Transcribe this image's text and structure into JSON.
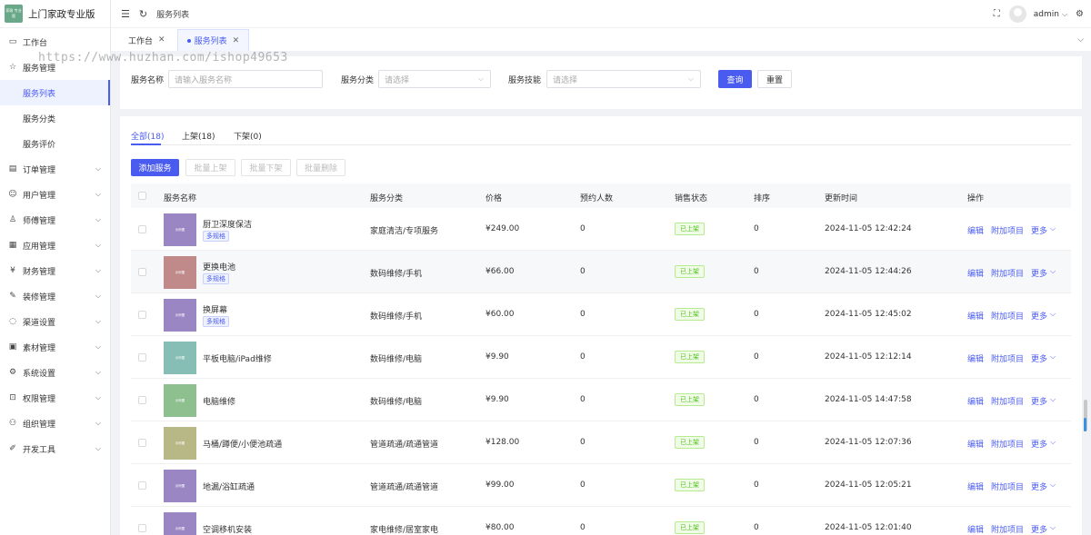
{
  "app": {
    "logo_text": "家政 专业版",
    "title": "上门家政专业版"
  },
  "sidebar": {
    "items": [
      {
        "label": "工作台",
        "icon": "monitor-icon"
      },
      {
        "label": "服务管理",
        "icon": "star-icon"
      },
      {
        "label": "服务列表",
        "sub": true,
        "active": true
      },
      {
        "label": "服务分类",
        "sub": true
      },
      {
        "label": "服务评价",
        "sub": true
      },
      {
        "label": "订单管理",
        "icon": "file-icon"
      },
      {
        "label": "用户管理",
        "icon": "user-icon"
      },
      {
        "label": "师傅管理",
        "icon": "worker-icon"
      },
      {
        "label": "应用管理",
        "icon": "grid-icon"
      },
      {
        "label": "财务管理",
        "icon": "money-icon"
      },
      {
        "label": "装修管理",
        "icon": "brush-icon"
      },
      {
        "label": "渠道设置",
        "icon": "chat-icon"
      },
      {
        "label": "素材管理",
        "icon": "image-icon"
      },
      {
        "label": "系统设置",
        "icon": "gear-icon"
      },
      {
        "label": "权限管理",
        "icon": "lock-icon"
      },
      {
        "label": "组织管理",
        "icon": "org-icon"
      },
      {
        "label": "开发工具",
        "icon": "tool-icon"
      }
    ]
  },
  "header": {
    "breadcrumb": "服务列表",
    "username": "admin"
  },
  "tabs": [
    {
      "label": "工作台"
    },
    {
      "label": "服务列表",
      "active": true
    }
  ],
  "watermark": "https://www.huzhan.com/ishop49653",
  "filter": {
    "name_label": "服务名称",
    "name_placeholder": "请输入服务名称",
    "category_label": "服务分类",
    "category_placeholder": "请选择",
    "skill_label": "服务技能",
    "skill_placeholder": "请选择",
    "search_label": "查询",
    "reset_label": "重置"
  },
  "status_tabs": [
    "全部(18)",
    "上架(18)",
    "下架(0)"
  ],
  "actions": {
    "add": "添加服务",
    "batch_on": "批量上架",
    "batch_off": "批量下架",
    "batch_delete": "批量删除"
  },
  "table": {
    "columns": [
      "服务名称",
      "服务分类",
      "价格",
      "预约人数",
      "销售状态",
      "排序",
      "更新时间",
      "操作"
    ],
    "thumb_label": "示例图",
    "op_edit": "编辑",
    "op_extra": "附加项目",
    "op_more": "更多",
    "rows": [
      {
        "name": "厨卫深度保洁",
        "tag": "多规格",
        "category": "家庭清洁/专项服务",
        "price": "¥249.00",
        "bookings": "0",
        "status": "已上架",
        "sort": "0",
        "updated": "2024-11-05 12:42:24",
        "thumb_color": "#9b86c4"
      },
      {
        "name": "更换电池",
        "tag": "多规格",
        "category": "数码维修/手机",
        "price": "¥66.00",
        "bookings": "0",
        "status": "已上架",
        "sort": "0",
        "updated": "2024-11-05 12:44:26",
        "thumb_color": "#c08a8a"
      },
      {
        "name": "换屏幕",
        "tag": "多规格",
        "category": "数码维修/手机",
        "price": "¥60.00",
        "bookings": "0",
        "status": "已上架",
        "sort": "0",
        "updated": "2024-11-05 12:45:02",
        "thumb_color": "#9b86c4"
      },
      {
        "name": "平板电脑/iPad维修",
        "tag": "",
        "category": "数码维修/电脑",
        "price": "¥9.90",
        "bookings": "0",
        "status": "已上架",
        "sort": "0",
        "updated": "2024-11-05 12:12:14",
        "thumb_color": "#86bdb5"
      },
      {
        "name": "电脑维修",
        "tag": "",
        "category": "数码维修/电脑",
        "price": "¥9.90",
        "bookings": "0",
        "status": "已上架",
        "sort": "0",
        "updated": "2024-11-05 14:47:58",
        "thumb_color": "#8dbf8f"
      },
      {
        "name": "马桶/蹲便/小便池疏通",
        "tag": "",
        "category": "管道疏通/疏通管道",
        "price": "¥128.00",
        "bookings": "0",
        "status": "已上架",
        "sort": "0",
        "updated": "2024-11-05 12:07:36",
        "thumb_color": "#b8b886"
      },
      {
        "name": "地漏/浴缸疏通",
        "tag": "",
        "category": "管道疏通/疏通管道",
        "price": "¥99.00",
        "bookings": "0",
        "status": "已上架",
        "sort": "0",
        "updated": "2024-11-05 12:05:21",
        "thumb_color": "#9b86c4"
      },
      {
        "name": "空调移机安装",
        "tag": "",
        "category": "家电维修/居室家电",
        "price": "¥80.00",
        "bookings": "0",
        "status": "已上架",
        "sort": "0",
        "updated": "2024-11-05 12:01:40",
        "thumb_color": "#9b86c4"
      }
    ]
  },
  "colors": {
    "accent": "#4a5cf0",
    "success": "#52c41a"
  }
}
